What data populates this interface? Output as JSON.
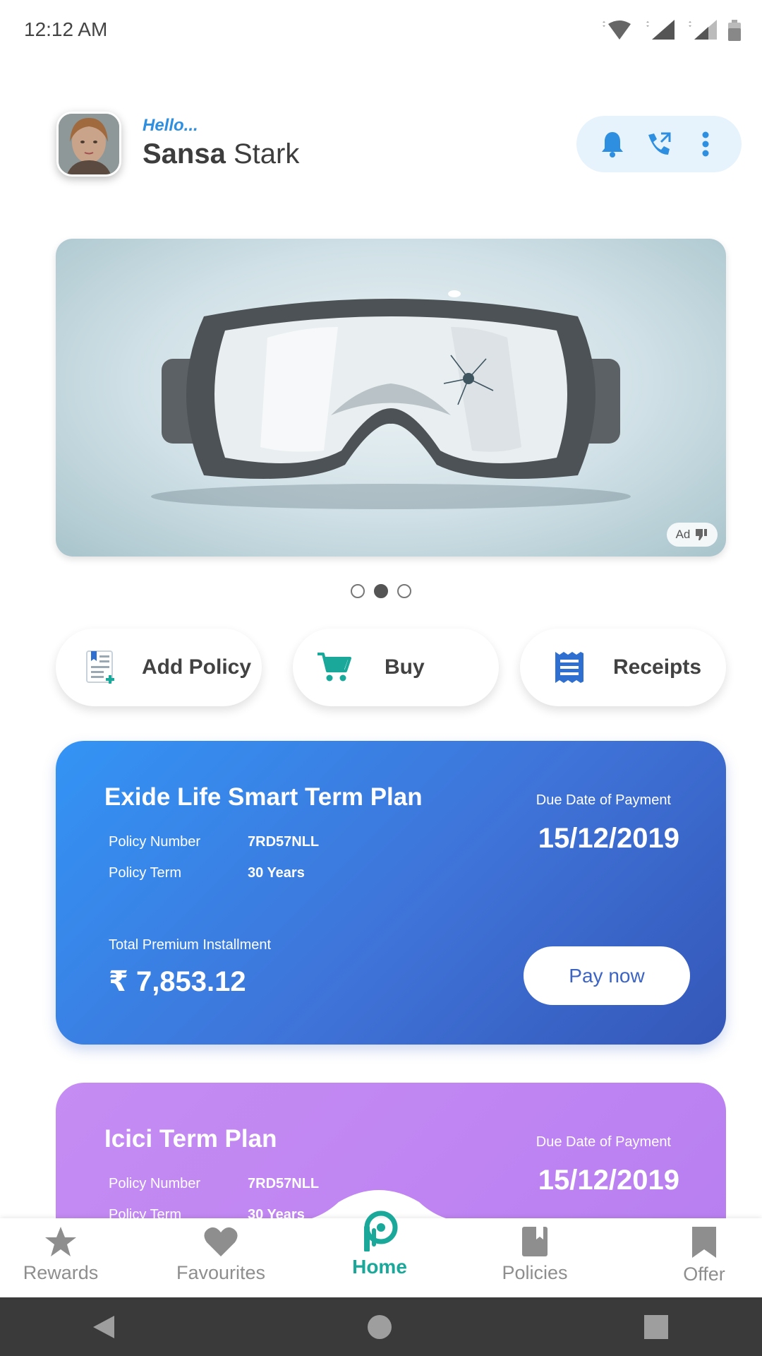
{
  "status_bar": {
    "time": "12:12 AM"
  },
  "header": {
    "greeting": "Hello...",
    "first_name": "Sansa",
    "last_name": "Stark",
    "actions": [
      "bell-icon",
      "phone-icon",
      "more-vert-icon"
    ]
  },
  "banner": {
    "ad_label": "Ad",
    "carousel": {
      "count": 3,
      "active_index": 1
    }
  },
  "quick_actions": [
    {
      "label": "Add Policy",
      "icon": "add-document-icon"
    },
    {
      "label": "Buy",
      "icon": "cart-icon"
    },
    {
      "label": "Receipts",
      "icon": "receipt-icon"
    }
  ],
  "policies": [
    {
      "title": "Exide Life Smart Term Plan",
      "policy_number_label": "Policy Number",
      "policy_number": "7RD57NLL",
      "policy_term_label": "Policy Term",
      "policy_term": "30 Years",
      "due_label": "Due Date of Payment",
      "due_date": "15/12/2019",
      "total_label": "Total Premium Installment",
      "total_amount": "₹ 7,853.12",
      "pay_label": "Pay now"
    },
    {
      "title": "Icici Term Plan",
      "policy_number_label": "Policy Number",
      "policy_number": "7RD57NLL",
      "policy_term_label": "Policy Term",
      "policy_term": "30 Years",
      "due_label": "Due Date of Payment",
      "due_date": "15/12/2019"
    }
  ],
  "bottom_nav": [
    {
      "label": "Rewards",
      "icon": "star-icon"
    },
    {
      "label": "Favourites",
      "icon": "heart-icon"
    },
    {
      "label": "Home",
      "icon": "home-logo-icon",
      "active": true
    },
    {
      "label": "Policies",
      "icon": "book-icon"
    },
    {
      "label": "Offer",
      "icon": "bookmark-icon"
    }
  ],
  "colors": {
    "accent": "#2e8fe0",
    "home_active": "#1aa89a",
    "card_blue": "#3f73d8",
    "card_purple": "#bf84f2"
  }
}
